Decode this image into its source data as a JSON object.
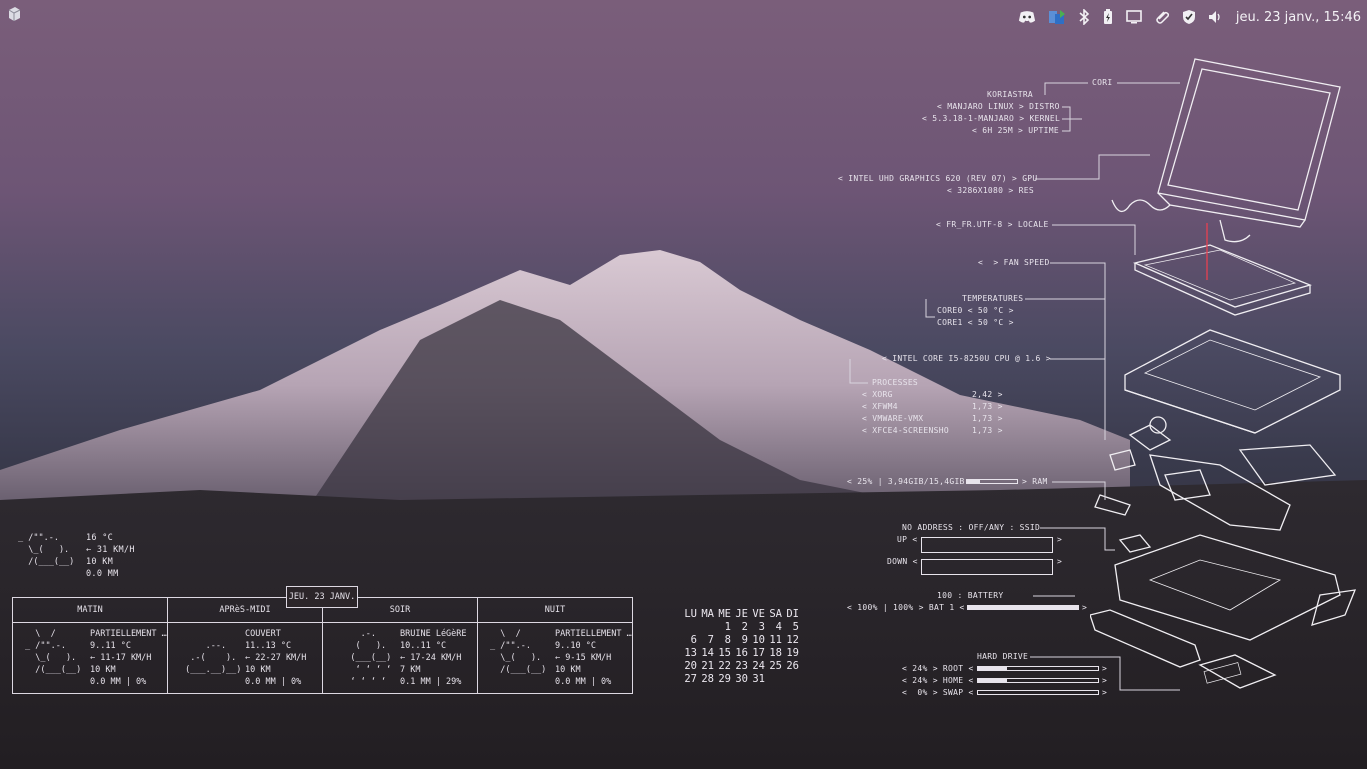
{
  "topbar": {
    "clock": "jeu. 23 janv., 15:46",
    "icons": [
      "discord-icon",
      "app-switch-icon",
      "bluetooth-icon",
      "battery-icon",
      "display-icon",
      "clip-icon",
      "shield-icon",
      "volume-icon"
    ]
  },
  "sysinfo": {
    "hostname": "CORI",
    "user": "KORIASTRA",
    "distro": "< MANJARO LINUX > DISTRO",
    "kernel": "< 5.3.18-1-MANJARO > KERNEL",
    "uptime": "< 6H 25M > UPTIME",
    "gpu": "< INTEL UHD GRAPHICS 620 (REV 07) > GPU",
    "res": "< 3286X1080 > RES",
    "locale": "< FR_FR.UTF-8 > LOCALE",
    "fan": "<  > FAN SPEED",
    "temps_title": "TEMPERATURES",
    "core0": "CORE0 < 50 °C >",
    "core1": "CORE1 < 50 °C >",
    "cpu": "< INTEL CORE I5-8250U CPU @ 1.6 >",
    "processes_title": "PROCESSES",
    "processes": [
      {
        "name": "< XORG",
        "val": "2,42 >"
      },
      {
        "name": "< XFWM4",
        "val": "1,73 >"
      },
      {
        "name": "< VMWARE-VMX",
        "val": "1,73 >"
      },
      {
        "name": "< XFCE4-SCREENSHO",
        "val": "1,73 >"
      }
    ],
    "ram_left": "< 25% | 3,94GIB/15,4GIB",
    "ram_right": "> RAM",
    "ram_percent": 25,
    "network": "NO ADDRESS : OFF/ANY : SSID",
    "up_label": "UP <",
    "down_label": "DOWN <",
    "net_close": ">",
    "battery_title": "100 : BATTERY",
    "battery_left": "< 100% | 100% > BAT 1 <",
    "battery_close": ">",
    "battery_percent": 100,
    "disk_title": "HARD DRIVE",
    "disks": [
      {
        "label": "< 24% > ROOT <",
        "percent": 24
      },
      {
        "label": "< 24% > HOME <",
        "percent": 24
      },
      {
        "label": "<  0% > SWAP <",
        "percent": 0
      }
    ],
    "disk_close": ">"
  },
  "weather_now": {
    "art": "_ /\"\".-.\n  \\_(   ).\n  /(___(__)",
    "temp": "16 °C",
    "wind": "← 31 KM/H",
    "visibility": "10 KM",
    "precip": "0.0 MM"
  },
  "forecast": {
    "date": "JEU. 23 JANV.",
    "periods": [
      {
        "name": "MATIN",
        "art": "  \\  /\n_ /\"\".-.\n  \\_(   ).\n  /(___(__)",
        "lines": "PARTIELLEMENT …\n9..11 °C\n← 11-17 KM/H\n10 KM\n0.0 MM | 0%"
      },
      {
        "name": "APRèS-MIDI",
        "art": "\n     .--.\n  .-(    ).\n (___.__)__)",
        "lines": "COUVERT\n11..13 °C\n← 22-27 KM/H\n10 KM\n0.0 MM | 0%"
      },
      {
        "name": "SOIR",
        "art": "     .-.\n    (   ).\n   (___(__)\n    ‘ ‘ ‘ ‘\n   ‘ ‘ ‘ ‘",
        "lines": "BRUINE LéGèRE\n10..11 °C\n← 17-24 KM/H\n7 KM\n0.1 MM | 29%"
      },
      {
        "name": "NUIT",
        "art": "  \\  /\n_ /\"\".-.\n  \\_(   ).\n  /(___(__)",
        "lines": "PARTIELLEMENT …\n9..10 °C\n← 9-15 KM/H\n10 KM\n0.0 MM | 0%"
      }
    ]
  },
  "calendar": {
    "weekdays": [
      "LU",
      "MA",
      "ME",
      "JE",
      "VE",
      "SA",
      "DI"
    ],
    "weeks": [
      [
        "",
        "",
        "1",
        "2",
        "3",
        "4",
        "5"
      ],
      [
        "6",
        "7",
        "8",
        "9",
        "10",
        "11",
        "12"
      ],
      [
        "13",
        "14",
        "15",
        "16",
        "17",
        "18",
        "19"
      ],
      [
        "20",
        "21",
        "22",
        "23",
        "24",
        "25",
        "26"
      ],
      [
        "27",
        "28",
        "29",
        "30",
        "31",
        "",
        ""
      ]
    ]
  }
}
